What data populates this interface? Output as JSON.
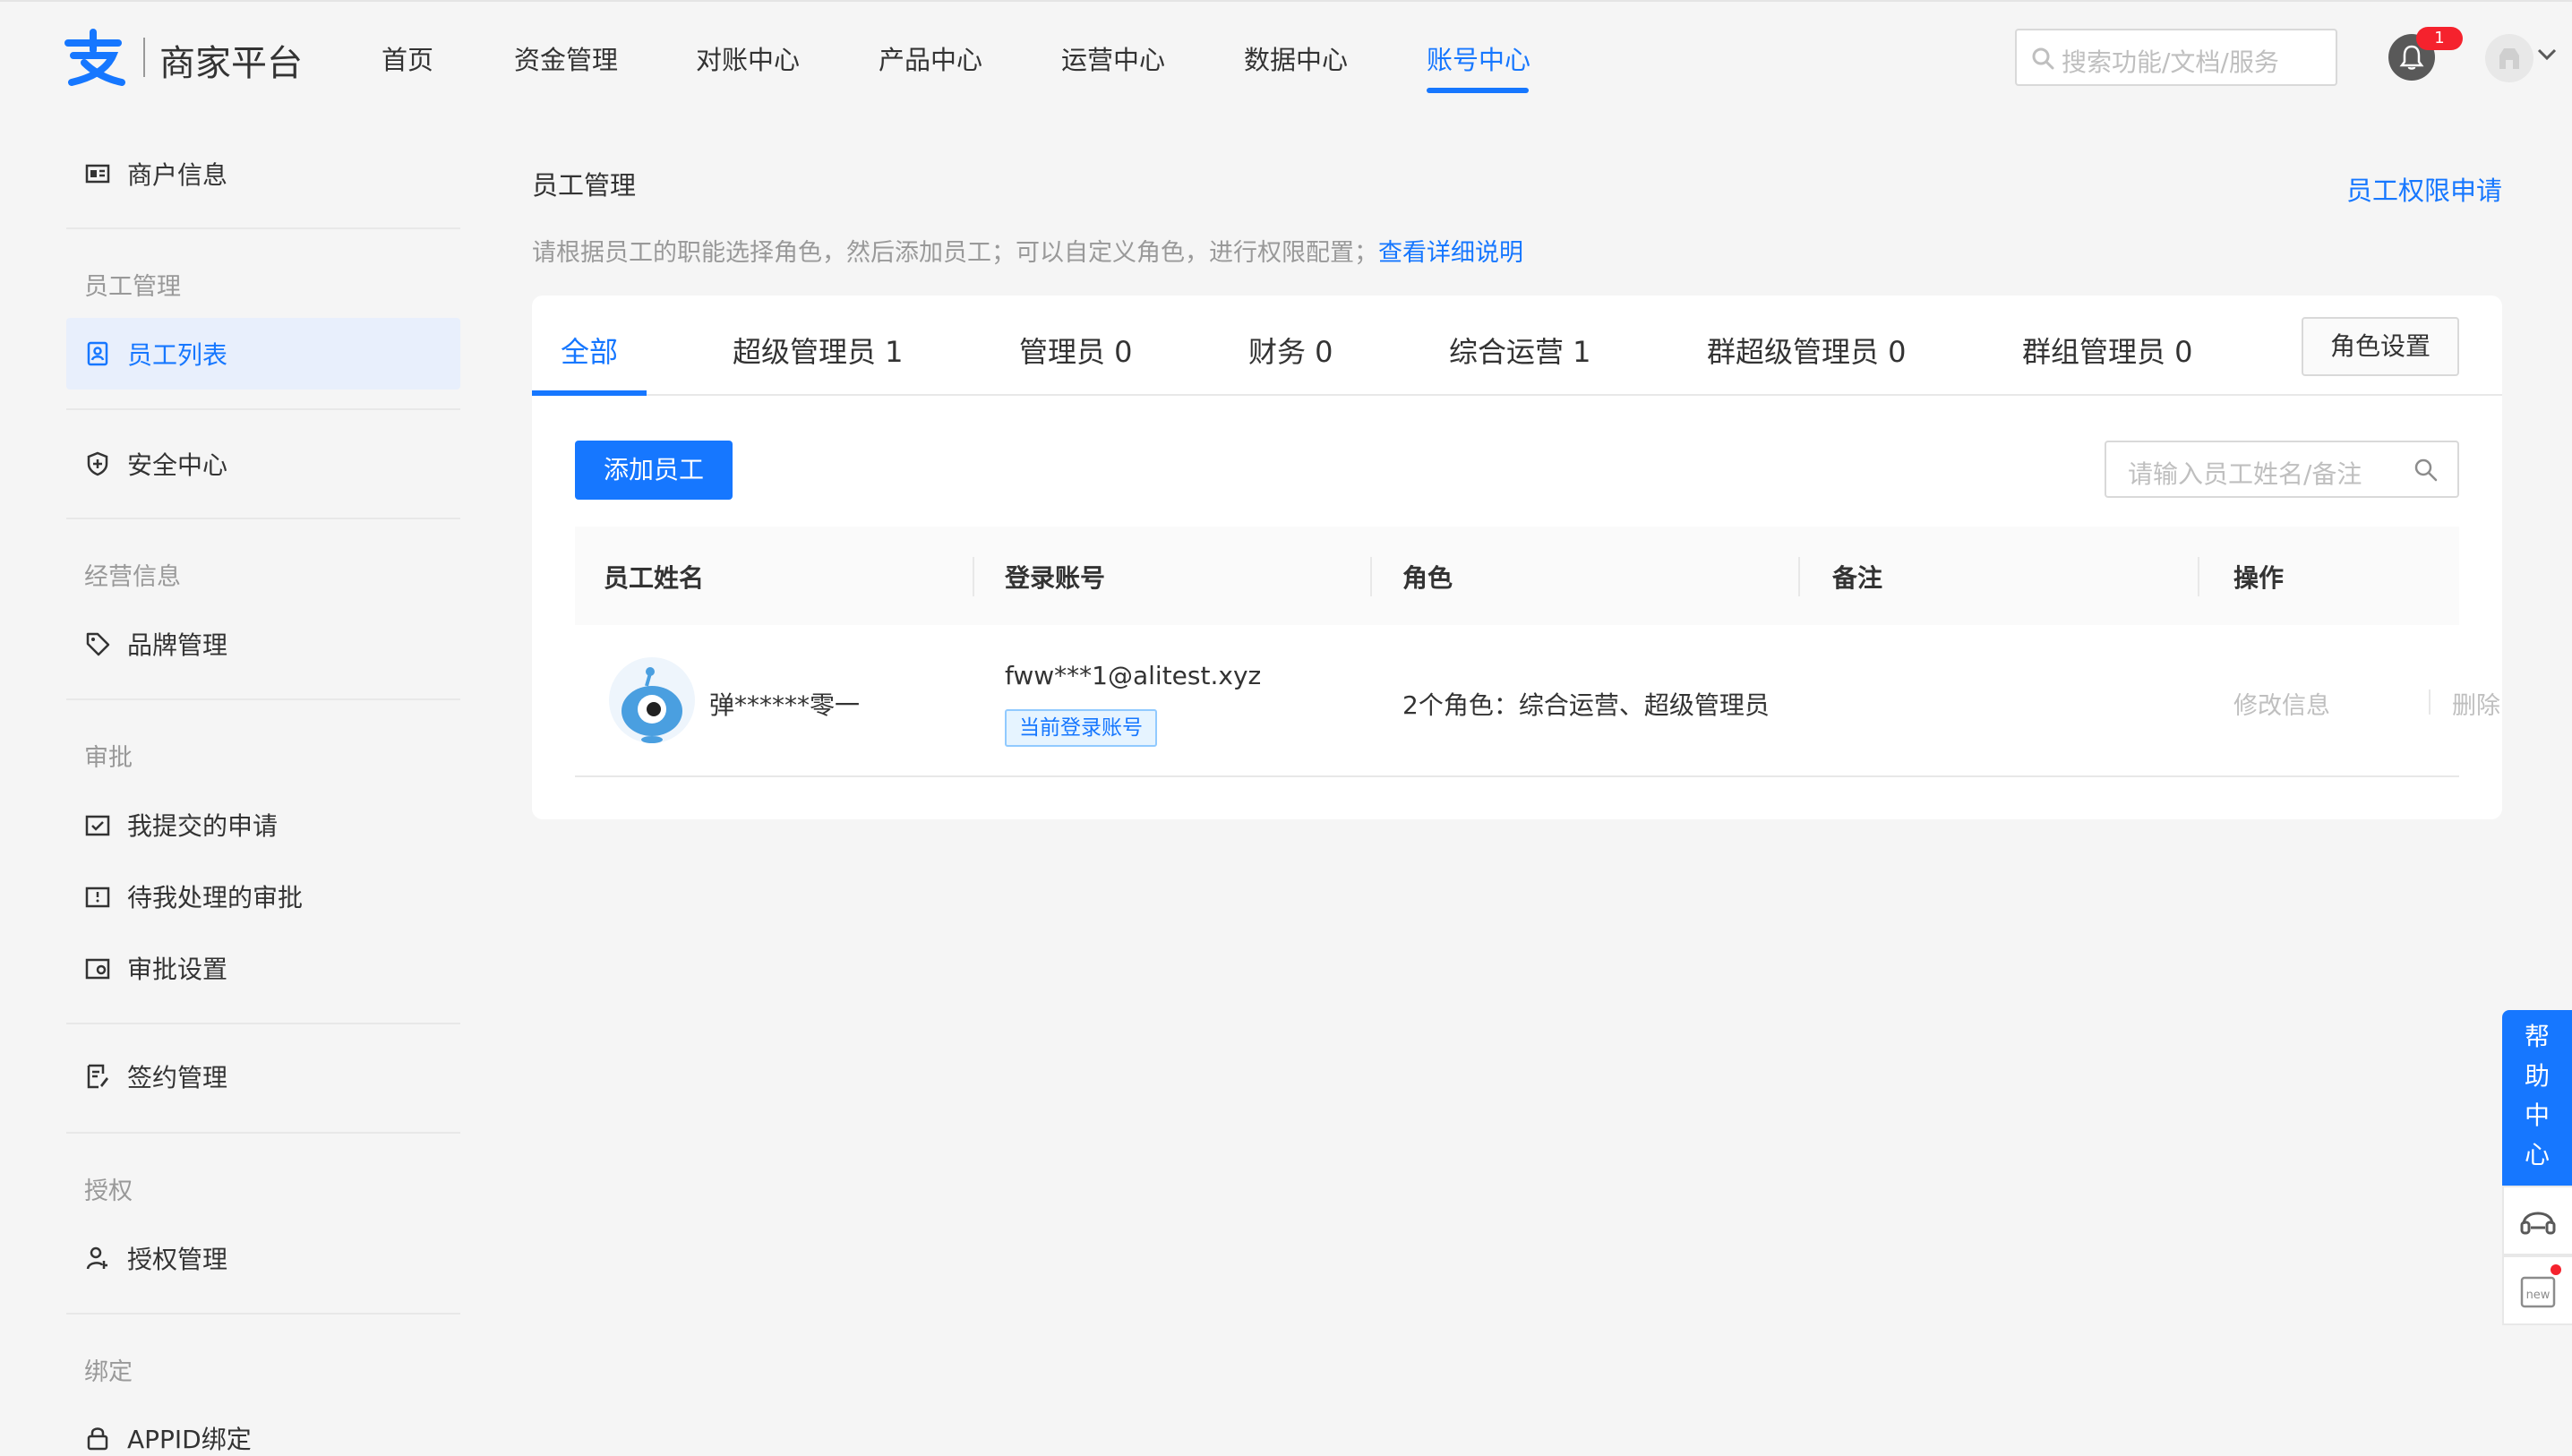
{
  "brand": {
    "name": "商家平台"
  },
  "nav": [
    {
      "label": "首页"
    },
    {
      "label": "资金管理"
    },
    {
      "label": "对账中心"
    },
    {
      "label": "产品中心"
    },
    {
      "label": "运营中心"
    },
    {
      "label": "数据中心"
    },
    {
      "label": "账号中心",
      "active": true
    }
  ],
  "top_search": {
    "placeholder": "搜索功能/文档/服务"
  },
  "notifications": {
    "count": "1"
  },
  "sidebar": {
    "merchant_info": "商户信息",
    "group_employee": "员工管理",
    "employee_list": "员工列表",
    "security_center": "安全中心",
    "group_business": "经营信息",
    "brand_manage": "品牌管理",
    "group_approval": "审批",
    "my_applications": "我提交的申请",
    "pending_approvals": "待我处理的审批",
    "approval_settings": "审批设置",
    "contract_manage": "签约管理",
    "group_auth": "授权",
    "auth_manage": "授权管理",
    "group_bind": "绑定",
    "appid_bind": "APPID绑定"
  },
  "main": {
    "title": "员工管理",
    "permission_link": "员工权限申请",
    "description": "请根据员工的职能选择角色，然后添加员工；可以自定义角色，进行权限配置；",
    "description_link": "查看详细说明",
    "tabs": [
      {
        "label": "全部",
        "active": true
      },
      {
        "label": "超级管理员 1"
      },
      {
        "label": "管理员 0"
      },
      {
        "label": "财务 0"
      },
      {
        "label": "综合运营 1"
      },
      {
        "label": "群超级管理员 0"
      },
      {
        "label": "群组管理员 0"
      }
    ],
    "role_settings": "角色设置",
    "add_employee": "添加员工",
    "employee_search": {
      "placeholder": "请输入员工姓名/备注"
    },
    "table": {
      "headers": [
        "员工姓名",
        "登录账号",
        "角色",
        "备注",
        "操作"
      ],
      "rows": [
        {
          "name": "弹******零一",
          "account": "fww***1@alitest.xyz",
          "current_tag": "当前登录账号",
          "roles": "2个角色：综合运营、超级管理员",
          "remark": "",
          "actions": [
            "修改信息",
            "删除"
          ]
        }
      ]
    }
  },
  "help": {
    "title": [
      "帮",
      "助",
      "中",
      "心"
    ],
    "new_label": "new"
  },
  "colors": {
    "accent": "#1677ff",
    "badge": "#f5222d",
    "muted": "#999999"
  }
}
